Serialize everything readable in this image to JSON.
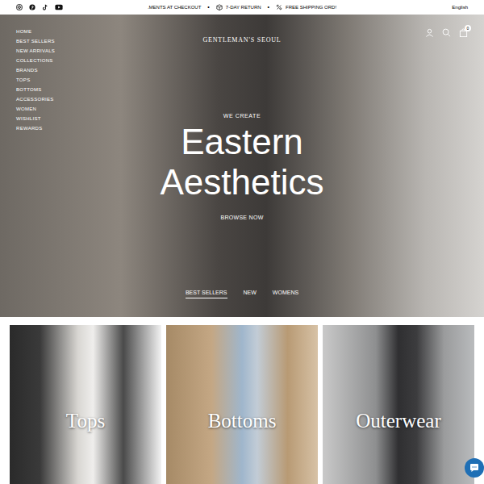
{
  "topbar": {
    "announcements": [
      ".MENTS AT CHECKOUT",
      "7-DAY RETURN",
      "FREE SHIPPING ORD!"
    ],
    "separator": "•",
    "language": "English"
  },
  "header": {
    "logo": "GENTLEMAN'S SEOUL",
    "cart_count": "0"
  },
  "nav": {
    "items": [
      "HOME",
      "BEST SELLERS",
      "NEW ARRIVALS",
      "COLLECTIONS",
      "BRANDS",
      "TOPS",
      "BOTTOMS",
      "ACCESSORIES",
      "WOMEN",
      "WISHLIST",
      "REWARDS"
    ]
  },
  "hero": {
    "eyebrow": "WE CREATE",
    "title_lines": [
      "Eastern",
      "Aesthetics"
    ],
    "cta": "BROWSE NOW",
    "tabs": [
      {
        "label": "BEST SELLERS",
        "selected": true
      },
      {
        "label": "NEW",
        "selected": false
      },
      {
        "label": "WOMENS",
        "selected": false
      }
    ]
  },
  "categories": [
    {
      "label": "Tops"
    },
    {
      "label": "Bottoms"
    },
    {
      "label": "Outerwear"
    }
  ]
}
